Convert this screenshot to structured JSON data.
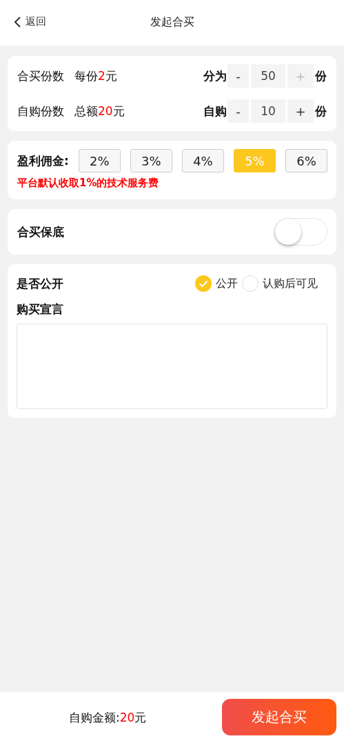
{
  "header": {
    "back_label": "返回",
    "title": "发起合买"
  },
  "quantity_rows": [
    {
      "label": "合买份数",
      "amount_prefix": "每份",
      "amount": "2",
      "amount_unit": "元",
      "stepper_label": "分为",
      "minus": "-",
      "value": "50",
      "plus": "+",
      "unit": "份",
      "plus_disabled": true
    },
    {
      "label": "自购份数",
      "amount_prefix": "总额",
      "amount": "20",
      "amount_unit": "元",
      "stepper_label": "自购",
      "minus": "-",
      "value": "10",
      "plus": "+",
      "unit": "份",
      "plus_disabled": false
    }
  ],
  "commission": {
    "label": "盈利佣金:",
    "options": [
      {
        "label": "2%",
        "selected": false
      },
      {
        "label": "3%",
        "selected": false
      },
      {
        "label": "4%",
        "selected": false
      },
      {
        "label": "5%",
        "selected": true
      },
      {
        "label": "6%",
        "selected": false
      }
    ],
    "note": "平台默认收取1%的技术服务费"
  },
  "guarantee": {
    "label": "合买保底",
    "on": false
  },
  "visibility": {
    "label": "是否公开",
    "options": [
      {
        "label": "公开",
        "selected": true
      },
      {
        "label": "认购后可见",
        "selected": false
      }
    ]
  },
  "declaration": {
    "label": "购买宣言"
  },
  "footer": {
    "amount_label": "自购金额:",
    "amount": "20",
    "amount_unit": "元",
    "submit_label": "发起合买"
  }
}
